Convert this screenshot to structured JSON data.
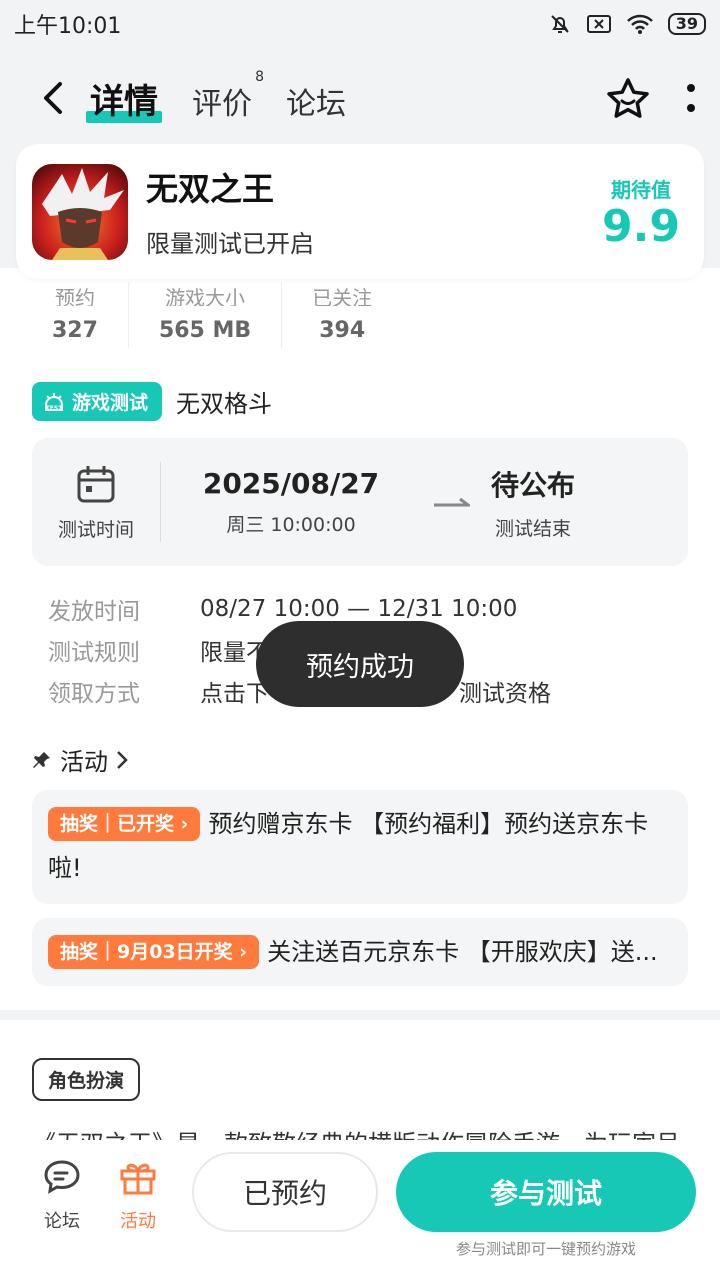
{
  "status_bar": {
    "time": "上午10:01",
    "battery": "39"
  },
  "nav": {
    "tabs": [
      {
        "label": "详情",
        "badge": ""
      },
      {
        "label": "评价",
        "badge": "8"
      },
      {
        "label": "论坛",
        "badge": ""
      }
    ],
    "icons": {
      "back": "back-arrow-icon",
      "favorite": "star-icon",
      "more": "more-vertical-icon"
    }
  },
  "game": {
    "name": "无双之王",
    "subtitle": "限量测试已开启",
    "expect_label": "期待值",
    "expect_score": "9.9"
  },
  "stats": [
    {
      "label": "预约",
      "value": "327"
    },
    {
      "label": "游戏大小",
      "value": "565 MB"
    },
    {
      "label": "已关注",
      "value": "394"
    }
  ],
  "test": {
    "badge": "游戏测试",
    "genre": "无双格斗",
    "time_label": "测试时间",
    "start_date": "2025/08/27",
    "start_weekday": "周三  10:00:00",
    "end_title": "待公布",
    "end_sub": "测试结束"
  },
  "info": [
    {
      "key": "发放时间",
      "value": "08/27 10:00 — 12/31 10:00"
    },
    {
      "key": "测试规则",
      "value": "限量不"
    },
    {
      "key": "领取方式",
      "value": "点击下"
    }
  ],
  "info_tail": "测试资格",
  "activity": {
    "title": "活动",
    "items": [
      {
        "tag": "抽奖｜已开奖 ›",
        "text": "预约赠京东卡 【预约福利】预约送京东卡啦!"
      },
      {
        "tag": "抽奖｜9月03日开奖 ›",
        "text": "关注送百元京东卡 【开服欢庆】送..."
      }
    ]
  },
  "genre_tag": "角色扮演",
  "desc_peek": "《无双之王》是一款致敬经典的横版动作冒险手游，为玩家呈",
  "bottom": {
    "forum": "论坛",
    "activity": "活动",
    "reserved": "已预约",
    "join": "参与测试",
    "join_hint": "参与测试即可一键预约游戏"
  },
  "toast": "预约成功",
  "colors": {
    "accent": "#16c8b5",
    "orange": "#ff7a3c"
  }
}
